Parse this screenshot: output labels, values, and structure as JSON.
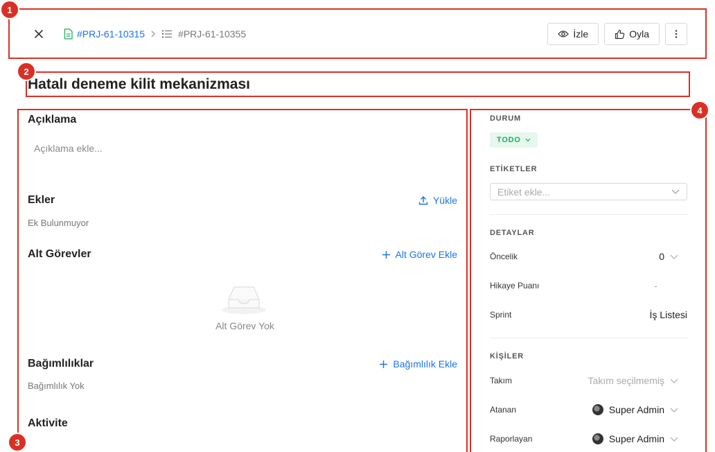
{
  "annotations": [
    "1",
    "2",
    "3",
    "4"
  ],
  "header": {
    "parent_id": "#PRJ-61-10315",
    "current_id": "#PRJ-61-10355",
    "watch_label": "İzle",
    "vote_label": "Oyla"
  },
  "title": "Hatalı deneme kilit mekanizması",
  "description": {
    "title": "Açıklama",
    "placeholder": "Açıklama ekle..."
  },
  "attachments": {
    "title": "Ekler",
    "action": "Yükle",
    "empty": "Ek Bulunmuyor"
  },
  "subtasks": {
    "title": "Alt Görevler",
    "action": "Alt Görev Ekle",
    "empty": "Alt Görev Yok"
  },
  "dependencies": {
    "title": "Bağımlılıklar",
    "action": "Bağımlılık Ekle",
    "empty": "Bağımlılık Yok"
  },
  "activity": {
    "title": "Aktivite"
  },
  "sidebar": {
    "status_label": "DURUM",
    "status_value": "TODO",
    "tags_label": "ETİKETLER",
    "tags_placeholder": "Etiket ekle...",
    "details_label": "DETAYLAR",
    "priority_label": "Öncelik",
    "priority_value": "0",
    "story_points_label": "Hikaye Puanı",
    "story_points_value": "-",
    "sprint_label": "Sprint",
    "sprint_value": "İş Listesi",
    "people_label": "KİŞİLER",
    "team_label": "Takım",
    "team_value": "Takım seçilmemiş",
    "assignee_label": "Atanan",
    "assignee_value": "Super Admin",
    "reporter_label": "Raporlayan",
    "reporter_value": "Super Admin"
  },
  "colors": {
    "accent": "#1a73e8",
    "status_green": "#1fad5e",
    "status_bg": "#e6f7ee",
    "annotation_red": "#d93025"
  }
}
